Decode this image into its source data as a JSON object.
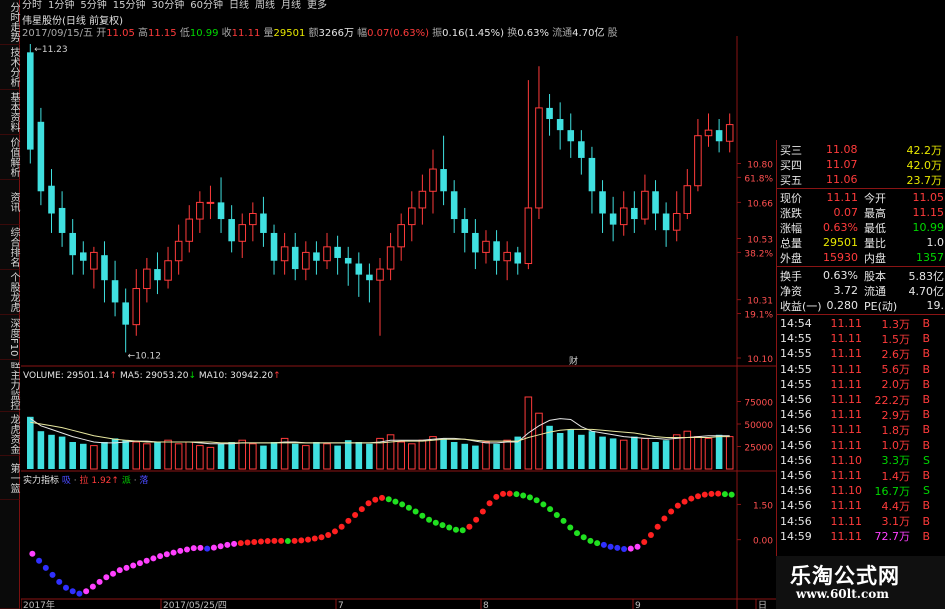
{
  "top_tabs": [
    "分时",
    "1分钟",
    "5分钟",
    "15分钟",
    "30分钟",
    "60分钟",
    "日线",
    "周线",
    "月线",
    "更多"
  ],
  "left_tabs": [
    "分时走势",
    "技术分析",
    "基本资料",
    "价值解析",
    "资讯",
    "综合排名",
    "个股龙虎",
    "深度F10",
    "联动关联"
  ],
  "bottom_left_tabs": [
    "主力监控",
    "龙虎资金",
    "第一篮"
  ],
  "chart_title": "伟星股份(日线 前复权)",
  "info_line": [
    {
      "t": "2017/09/15/五 ",
      "c": "gr"
    },
    {
      "t": "开",
      "c": "gr"
    },
    {
      "t": "11.05",
      "c": "r"
    },
    {
      "t": " 高",
      "c": "gr"
    },
    {
      "t": "11.15",
      "c": "r"
    },
    {
      "t": " 低",
      "c": "gr"
    },
    {
      "t": "10.99",
      "c": "g"
    },
    {
      "t": " 收",
      "c": "gr"
    },
    {
      "t": "11.11",
      "c": "r"
    },
    {
      "t": " 量",
      "c": "gr"
    },
    {
      "t": "29501",
      "c": "y"
    },
    {
      "t": " 额",
      "c": "gr"
    },
    {
      "t": "3266万",
      "c": "w"
    },
    {
      "t": " 幅",
      "c": "gr"
    },
    {
      "t": "0.07(0.63%)",
      "c": "r"
    },
    {
      "t": " 振",
      "c": "gr"
    },
    {
      "t": "0.16(1.45%)",
      "c": "w"
    },
    {
      "t": " 换",
      "c": "gr"
    },
    {
      "t": "0.63%",
      "c": "w"
    },
    {
      "t": " 流通",
      "c": "gr"
    },
    {
      "t": "4.70亿",
      "c": "w"
    },
    {
      "t": " 股",
      "c": "gr"
    }
  ],
  "price_axis": {
    "labels": [
      "10.80",
      "61.8%",
      "10.66",
      "10.53",
      "38.2%",
      "10.31",
      "19.1%",
      "10.10"
    ],
    "ticks": [
      10.8,
      10.75,
      10.66,
      10.53,
      10.48,
      10.31,
      10.26,
      10.1
    ]
  },
  "candle_annotations": {
    "high": "←11.23",
    "low": "←10.12",
    "news": "财"
  },
  "volume_header": [
    {
      "t": "VOLUME: 29501.14",
      "c": "w"
    },
    {
      "t": "↑",
      "c": "r"
    },
    {
      "t": "  MA5: 29053.20",
      "c": "w"
    },
    {
      "t": "↓",
      "c": "g"
    },
    {
      "t": "  MA10: 30942.20",
      "c": "w"
    },
    {
      "t": "↑",
      "c": "r"
    }
  ],
  "volume_axis": [
    "75000",
    "50000",
    "25000"
  ],
  "indicator_header": [
    {
      "t": "实力指标",
      "c": "w"
    },
    {
      "t": " 吸",
      "c": "b"
    },
    {
      "t": " · ",
      "c": "gr"
    },
    {
      "t": "拉",
      "c": "r"
    },
    {
      "t": " 1.92",
      "c": "r"
    },
    {
      "t": "↑",
      "c": "r"
    },
    {
      "t": "  派",
      "c": "g"
    },
    {
      "t": " · ",
      "c": "gr"
    },
    {
      "t": "落",
      "c": "b"
    }
  ],
  "indicator_axis": [
    "1.50",
    "0.00"
  ],
  "date_axis": [
    "2017年",
    "2017/05/25/四",
    "7",
    "8",
    "9",
    "日"
  ],
  "order_book": [
    {
      "label": "买三",
      "price": "11.08",
      "vol": "42.2万"
    },
    {
      "label": "买四",
      "price": "11.07",
      "vol": "42.0万"
    },
    {
      "label": "买五",
      "price": "11.06",
      "vol": "23.7万"
    }
  ],
  "quote": [
    {
      "l1": "现价",
      "v1": "11.11",
      "c1": "r",
      "l2": "今开",
      "v2": "11.05",
      "c2": "r"
    },
    {
      "l1": "涨跌",
      "v1": "0.07",
      "c1": "r",
      "l2": "最高",
      "v2": "11.15",
      "c2": "r"
    },
    {
      "l1": "涨幅",
      "v1": "0.63%",
      "c1": "r",
      "l2": "最低",
      "v2": "10.99",
      "c2": "g"
    },
    {
      "l1": "总量",
      "v1": "29501",
      "c1": "y",
      "l2": "量比",
      "v2": "1.0",
      "c2": "w"
    },
    {
      "l1": "外盘",
      "v1": "15930",
      "c1": "r",
      "l2": "内盘",
      "v2": "1357",
      "c2": "g"
    }
  ],
  "fundamentals": [
    {
      "l1": "换手",
      "v1": "0.63%",
      "l2": "股本",
      "v2": "5.83亿"
    },
    {
      "l1": "净资",
      "v1": "3.72",
      "l2": "流通",
      "v2": "4.70亿"
    },
    {
      "l1": "收益(一)",
      "v1": "0.280",
      "l2": "PE(动)",
      "v2": "19."
    }
  ],
  "ticks": [
    {
      "time": "14:54",
      "price": "11.11",
      "vol": "1.3万",
      "dir": "B"
    },
    {
      "time": "14:55",
      "price": "11.11",
      "vol": "1.5万",
      "dir": "B"
    },
    {
      "time": "14:55",
      "price": "11.11",
      "vol": "2.6万",
      "dir": "B"
    },
    {
      "time": "14:55",
      "price": "11.11",
      "vol": "5.6万",
      "dir": "B"
    },
    {
      "time": "14:55",
      "price": "11.11",
      "vol": "2.0万",
      "dir": "B"
    },
    {
      "time": "14:56",
      "price": "11.11",
      "vol": "22.2万",
      "dir": "B"
    },
    {
      "time": "14:56",
      "price": "11.11",
      "vol": "2.9万",
      "dir": "B"
    },
    {
      "time": "14:56",
      "price": "11.11",
      "vol": "1.8万",
      "dir": "B"
    },
    {
      "time": "14:56",
      "price": "11.11",
      "vol": "1.0万",
      "dir": "B"
    },
    {
      "time": "14:56",
      "price": "11.10",
      "vol": "3.3万",
      "dir": "S"
    },
    {
      "time": "14:56",
      "price": "11.11",
      "vol": "1.4万",
      "dir": "B"
    },
    {
      "time": "14:56",
      "price": "11.10",
      "vol": "16.7万",
      "dir": "S"
    },
    {
      "time": "14:56",
      "price": "11.11",
      "vol": "4.4万",
      "dir": "B"
    },
    {
      "time": "14:56",
      "price": "11.11",
      "vol": "3.1万",
      "dir": "B"
    },
    {
      "time": "14:59",
      "price": "11.11",
      "vol": "72.7万",
      "dir": "B"
    }
  ],
  "brand": {
    "name": "乐淘公式网",
    "url": "www.60lt.com"
  },
  "colors": {
    "up": "#ff3b3b",
    "down": "#40e0e0",
    "border": "#8a1414",
    "ma5": "#e6e6e6",
    "ma10": "#e8e8a0"
  },
  "chart_data": {
    "type": "candlestick",
    "price_range": [
      10.1,
      11.23
    ],
    "candles": [
      [
        11.2,
        10.85,
        11.23,
        10.8
      ],
      [
        10.95,
        10.7,
        11.0,
        10.65
      ],
      [
        10.72,
        10.62,
        10.78,
        10.55
      ],
      [
        10.64,
        10.55,
        10.7,
        10.5
      ],
      [
        10.55,
        10.47,
        10.6,
        10.4
      ],
      [
        10.48,
        10.45,
        10.52,
        10.4
      ],
      [
        10.42,
        10.48,
        10.5,
        10.35
      ],
      [
        10.47,
        10.38,
        10.52,
        10.3
      ],
      [
        10.38,
        10.3,
        10.45,
        10.25
      ],
      [
        10.3,
        10.22,
        10.35,
        10.12
      ],
      [
        10.22,
        10.35,
        10.42,
        10.18
      ],
      [
        10.35,
        10.42,
        10.46,
        10.3
      ],
      [
        10.42,
        10.38,
        10.48,
        10.33
      ],
      [
        10.38,
        10.45,
        10.5,
        10.35
      ],
      [
        10.45,
        10.52,
        10.58,
        10.4
      ],
      [
        10.52,
        10.6,
        10.65,
        10.48
      ],
      [
        10.6,
        10.66,
        10.7,
        10.55
      ],
      [
        10.66,
        10.66,
        10.72,
        10.6
      ],
      [
        10.66,
        10.6,
        10.75,
        10.55
      ],
      [
        10.6,
        10.52,
        10.65,
        10.48
      ],
      [
        10.52,
        10.58,
        10.62,
        10.46
      ],
      [
        10.58,
        10.62,
        10.66,
        10.52
      ],
      [
        10.62,
        10.55,
        10.68,
        10.5
      ],
      [
        10.55,
        10.45,
        10.58,
        10.4
      ],
      [
        10.45,
        10.5,
        10.55,
        10.4
      ],
      [
        10.5,
        10.42,
        10.55,
        10.38
      ],
      [
        10.42,
        10.48,
        10.52,
        10.38
      ],
      [
        10.48,
        10.45,
        10.52,
        10.4
      ],
      [
        10.45,
        10.5,
        10.55,
        10.42
      ],
      [
        10.5,
        10.46,
        10.54,
        10.4
      ],
      [
        10.46,
        10.44,
        10.5,
        10.36
      ],
      [
        10.44,
        10.4,
        10.48,
        10.32
      ],
      [
        10.4,
        10.38,
        10.44,
        10.3
      ],
      [
        10.38,
        10.42,
        10.46,
        10.18
      ],
      [
        10.42,
        10.5,
        10.55,
        10.38
      ],
      [
        10.5,
        10.58,
        10.62,
        10.45
      ],
      [
        10.58,
        10.64,
        10.7,
        10.52
      ],
      [
        10.64,
        10.7,
        10.76,
        10.58
      ],
      [
        10.7,
        10.78,
        10.85,
        10.62
      ],
      [
        10.78,
        10.7,
        10.9,
        10.65
      ],
      [
        10.7,
        10.6,
        10.74,
        10.55
      ],
      [
        10.6,
        10.55,
        10.64,
        10.48
      ],
      [
        10.55,
        10.48,
        10.6,
        10.42
      ],
      [
        10.48,
        10.52,
        10.56,
        10.44
      ],
      [
        10.52,
        10.45,
        10.56,
        10.4
      ],
      [
        10.45,
        10.48,
        10.52,
        10.38
      ],
      [
        10.48,
        10.44,
        10.5,
        10.4
      ],
      [
        10.44,
        10.64,
        11.1,
        10.42
      ],
      [
        10.64,
        11.0,
        11.15,
        10.6
      ],
      [
        11.0,
        10.96,
        11.05,
        10.9
      ],
      [
        10.96,
        10.92,
        11.02,
        10.85
      ],
      [
        10.92,
        10.88,
        10.98,
        10.82
      ],
      [
        10.88,
        10.82,
        10.92,
        10.76
      ],
      [
        10.82,
        10.7,
        10.86,
        10.62
      ],
      [
        10.7,
        10.62,
        10.74,
        10.55
      ],
      [
        10.62,
        10.58,
        10.68,
        10.52
      ],
      [
        10.58,
        10.64,
        10.7,
        10.54
      ],
      [
        10.64,
        10.6,
        10.7,
        10.55
      ],
      [
        10.6,
        10.7,
        10.76,
        10.58
      ],
      [
        10.7,
        10.62,
        10.74,
        10.56
      ],
      [
        10.62,
        10.56,
        10.66,
        10.5
      ],
      [
        10.56,
        10.62,
        10.7,
        10.52
      ],
      [
        10.62,
        10.72,
        10.78,
        10.6
      ],
      [
        10.72,
        10.9,
        10.96,
        10.7
      ],
      [
        10.9,
        10.92,
        10.98,
        10.86
      ],
      [
        10.92,
        10.88,
        10.96,
        10.84
      ],
      [
        10.88,
        10.94,
        10.98,
        10.84
      ]
    ],
    "volumes": [
      58,
      42,
      38,
      36,
      30,
      28,
      26,
      30,
      34,
      32,
      30,
      28,
      30,
      32,
      28,
      30,
      26,
      24,
      28,
      30,
      32,
      28,
      26,
      30,
      34,
      28,
      26,
      30,
      28,
      26,
      32,
      30,
      28,
      34,
      38,
      30,
      28,
      32,
      36,
      34,
      30,
      28,
      26,
      30,
      28,
      32,
      36,
      80,
      62,
      48,
      40,
      44,
      38,
      42,
      36,
      34,
      32,
      36,
      34,
      30,
      32,
      38,
      42,
      36,
      34,
      38,
      36
    ],
    "ma5": [
      56,
      48,
      44,
      40,
      36,
      33,
      30,
      29,
      29,
      30,
      31,
      31,
      30,
      30,
      30,
      30,
      29,
      28,
      28,
      28,
      29,
      29,
      29,
      29,
      30,
      30,
      29,
      29,
      29,
      29,
      29,
      29,
      29,
      30,
      32,
      32,
      32,
      32,
      33,
      34,
      34,
      33,
      31,
      29,
      29,
      30,
      30,
      40,
      48,
      54,
      56,
      55,
      47,
      42,
      40,
      38,
      36,
      35,
      34,
      34,
      33,
      34,
      35,
      36,
      37,
      37,
      37
    ],
    "ma10": [
      52,
      50,
      48,
      46,
      43,
      40,
      37,
      35,
      33,
      32,
      31,
      30,
      30,
      30,
      30,
      30,
      30,
      30,
      29,
      29,
      29,
      29,
      29,
      29,
      29,
      29,
      29,
      29,
      29,
      29,
      29,
      29,
      29,
      29,
      30,
      31,
      31,
      31,
      32,
      33,
      33,
      33,
      32,
      31,
      31,
      31,
      31,
      35,
      38,
      41,
      43,
      44,
      44,
      44,
      43,
      42,
      41,
      40,
      38,
      36,
      35,
      35,
      35,
      35,
      35,
      36,
      36
    ],
    "indicator": [
      -0.6,
      -0.9,
      -1.2,
      -1.5,
      -1.8,
      -2.05,
      -2.2,
      -2.3,
      -2.2,
      -2.0,
      -1.8,
      -1.6,
      -1.45,
      -1.3,
      -1.2,
      -1.1,
      -1.0,
      -0.9,
      -0.8,
      -0.7,
      -0.62,
      -0.55,
      -0.48,
      -0.42,
      -0.36,
      -0.35,
      -0.38,
      -0.34,
      -0.28,
      -0.22,
      -0.18,
      -0.15,
      -0.12,
      -0.1,
      -0.08,
      -0.06,
      -0.05,
      -0.05,
      -0.06,
      -0.05,
      -0.03,
      0,
      0.05,
      0.1,
      0.2,
      0.35,
      0.55,
      0.8,
      1.05,
      1.3,
      1.55,
      1.7,
      1.78,
      1.72,
      1.62,
      1.5,
      1.36,
      1.2,
      1.02,
      0.85,
      0.72,
      0.62,
      0.52,
      0.42,
      0.4,
      0.55,
      0.85,
      1.2,
      1.55,
      1.82,
      1.95,
      1.96,
      1.94,
      1.88,
      1.8,
      1.68,
      1.5,
      1.3,
      1.05,
      0.8,
      0.52,
      0.28,
      0.1,
      -0.05,
      -0.15,
      -0.22,
      -0.3,
      -0.35,
      -0.4,
      -0.38,
      -0.3,
      -0.1,
      0.2,
      0.55,
      0.9,
      1.2,
      1.45,
      1.62,
      1.75,
      1.85,
      1.92,
      1.95,
      1.96,
      1.94,
      1.92
    ]
  }
}
